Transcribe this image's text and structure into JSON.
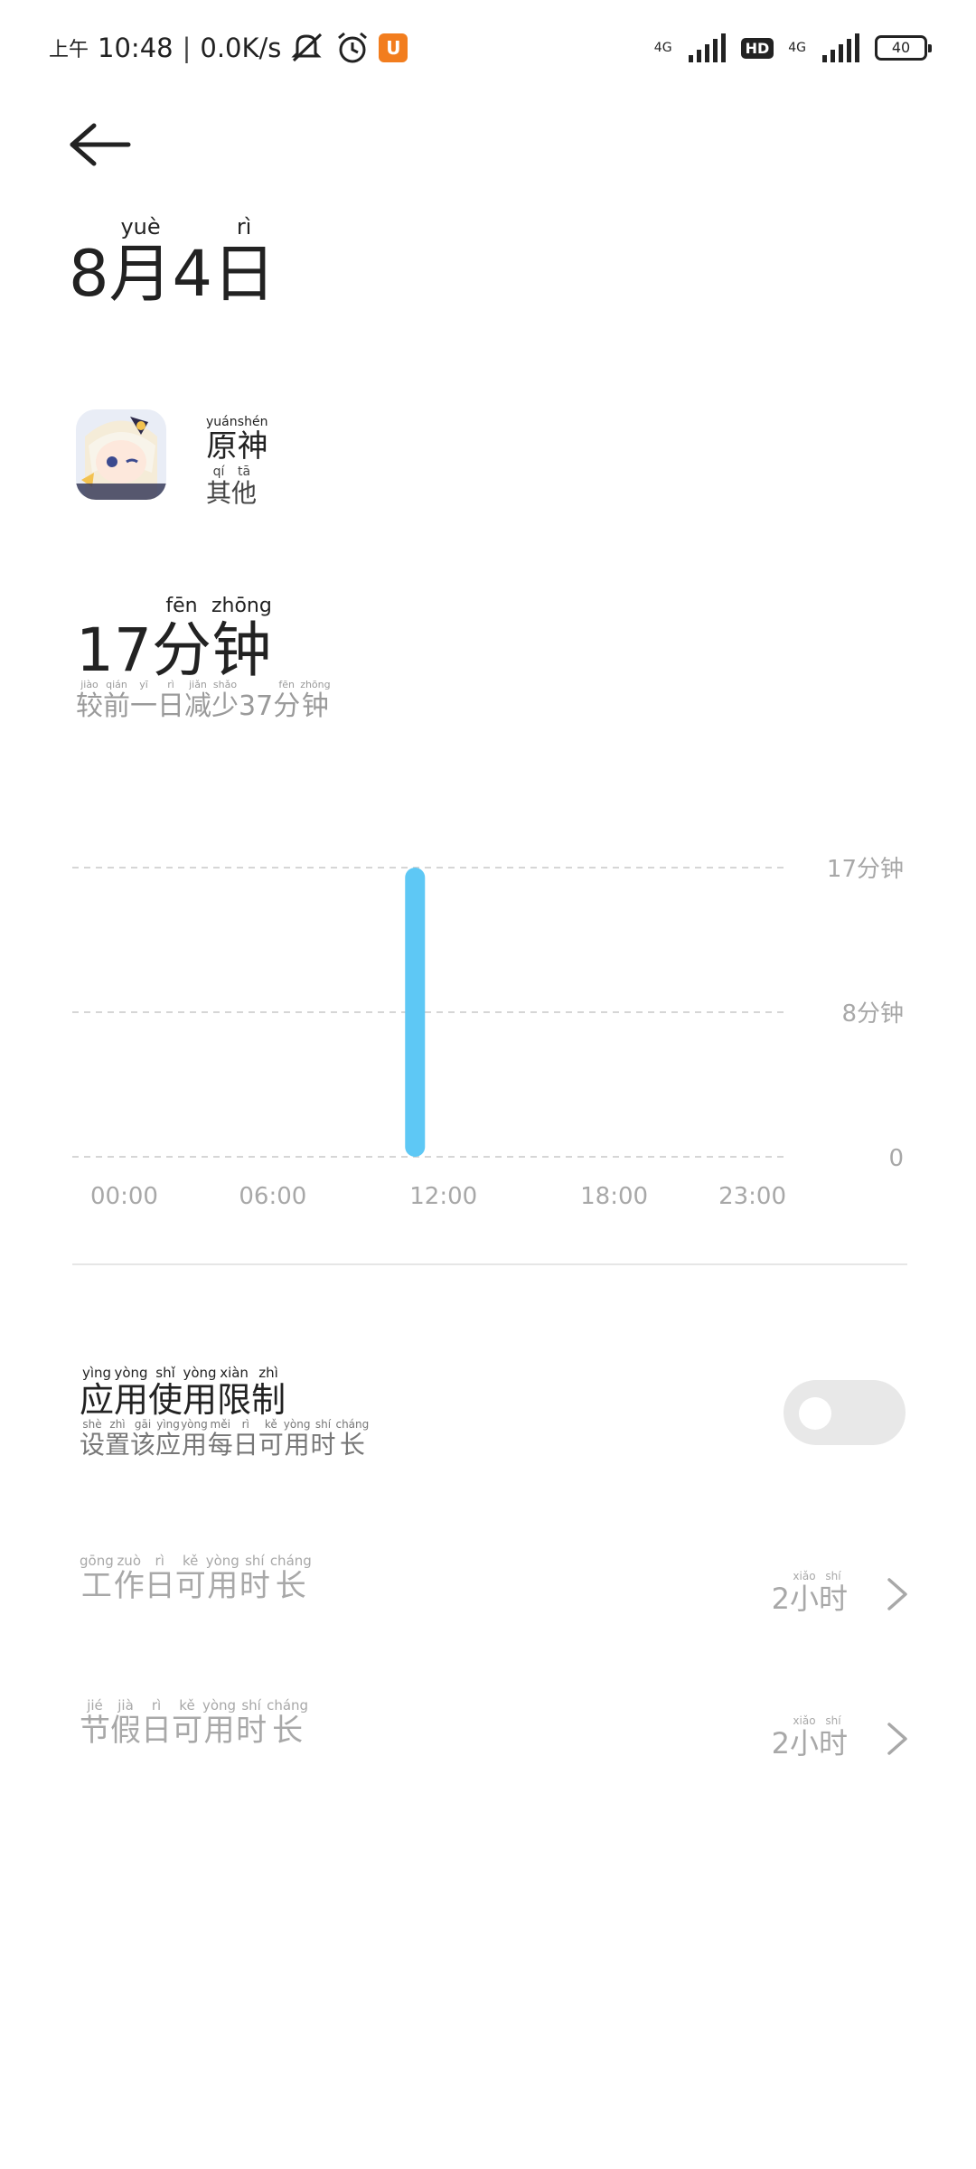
{
  "status_bar": {
    "time_prefix": "上午",
    "time": "10:48",
    "net_speed": "0.0K/s",
    "network_1": "4G",
    "hd": "HD",
    "network_2": "4G",
    "battery": "40"
  },
  "header": {
    "date": {
      "month": "8",
      "month_unit": "月",
      "month_unit_py": "yuè",
      "day": "4",
      "day_unit": "日",
      "day_unit_py": "rì"
    }
  },
  "app": {
    "icon": "genshin-impact-app-icon",
    "name": [
      {
        "c": "原",
        "p": "yuán"
      },
      {
        "c": "神",
        "p": "shén"
      }
    ],
    "category": [
      {
        "c": "其",
        "p": "qí"
      },
      {
        "c": "他",
        "p": "tā"
      }
    ]
  },
  "usage": {
    "total_minutes": "17",
    "unit": [
      {
        "c": "分",
        "p": "fēn"
      },
      {
        "c": "钟",
        "p": "zhōng"
      }
    ],
    "compare": [
      {
        "c": "较",
        "p": "jiào"
      },
      {
        "c": "前",
        "p": "qián"
      },
      {
        "c": "一",
        "p": "yī"
      },
      {
        "c": "日",
        "p": "rì"
      },
      {
        "c": "减",
        "p": "jiǎn"
      },
      {
        "c": "少",
        "p": "shǎo"
      },
      {
        "c": "37",
        "p": ""
      },
      {
        "c": "分",
        "p": "fēn"
      },
      {
        "c": "钟",
        "p": "zhōng"
      }
    ]
  },
  "chart_data": {
    "type": "bar",
    "x_ticks": [
      "00:00",
      "06:00",
      "12:00",
      "18:00",
      "23:00"
    ],
    "y_ticks": [
      {
        "value": 17,
        "label": "17",
        "unit": [
          {
            "c": "分",
            "p": "fēn"
          },
          {
            "c": "钟",
            "p": "zhōng"
          }
        ]
      },
      {
        "value": 8.5,
        "label": "8",
        "unit": [
          {
            "c": "分",
            "p": "fēn"
          },
          {
            "c": "钟",
            "p": "zhōng"
          }
        ]
      },
      {
        "value": 0,
        "label": "0",
        "unit": []
      }
    ],
    "ylim": [
      0,
      17
    ],
    "bars": [
      {
        "hour": 11,
        "value": 17
      }
    ],
    "color": "#5ec8f5",
    "grid": true,
    "grid_style": "dashed"
  },
  "limit": {
    "title": [
      {
        "c": "应",
        "p": "yìng"
      },
      {
        "c": "用",
        "p": "yòng"
      },
      {
        "c": "使",
        "p": "shǐ"
      },
      {
        "c": "用",
        "p": "yòng"
      },
      {
        "c": "限",
        "p": "xiàn"
      },
      {
        "c": "制",
        "p": "zhì"
      }
    ],
    "subtitle": [
      {
        "c": "设",
        "p": "shè"
      },
      {
        "c": "置",
        "p": "zhì"
      },
      {
        "c": "该",
        "p": "gāi"
      },
      {
        "c": "应",
        "p": "yìng"
      },
      {
        "c": "用",
        "p": "yòng"
      },
      {
        "c": "每",
        "p": "měi"
      },
      {
        "c": "日",
        "p": "rì"
      },
      {
        "c": "可",
        "p": "kě"
      },
      {
        "c": "用",
        "p": "yòng"
      },
      {
        "c": "时",
        "p": "shí"
      },
      {
        "c": "长",
        "p": "cháng"
      }
    ],
    "enabled": false,
    "rows": [
      {
        "label": [
          {
            "c": "工",
            "p": "gōng"
          },
          {
            "c": "作",
            "p": "zuò"
          },
          {
            "c": "日",
            "p": "rì"
          },
          {
            "c": "可",
            "p": "kě"
          },
          {
            "c": "用",
            "p": "yòng"
          },
          {
            "c": "时",
            "p": "shí"
          },
          {
            "c": "长",
            "p": "cháng"
          }
        ],
        "value": "2",
        "value_unit": [
          {
            "c": "小",
            "p": "xiǎo"
          },
          {
            "c": "时",
            "p": "shí"
          }
        ]
      },
      {
        "label": [
          {
            "c": "节",
            "p": "jié"
          },
          {
            "c": "假",
            "p": "jià"
          },
          {
            "c": "日",
            "p": "rì"
          },
          {
            "c": "可",
            "p": "kě"
          },
          {
            "c": "用",
            "p": "yòng"
          },
          {
            "c": "时",
            "p": "shí"
          },
          {
            "c": "长",
            "p": "cháng"
          }
        ],
        "value": "2",
        "value_unit": [
          {
            "c": "小",
            "p": "xiǎo"
          },
          {
            "c": "时",
            "p": "shí"
          }
        ]
      }
    ]
  },
  "colors": {
    "accent": "#5ec8f5",
    "text": "#222222",
    "muted": "#a8a8a8",
    "divider": "#e6e6e6",
    "toggle_off": "#e8e8e8"
  }
}
